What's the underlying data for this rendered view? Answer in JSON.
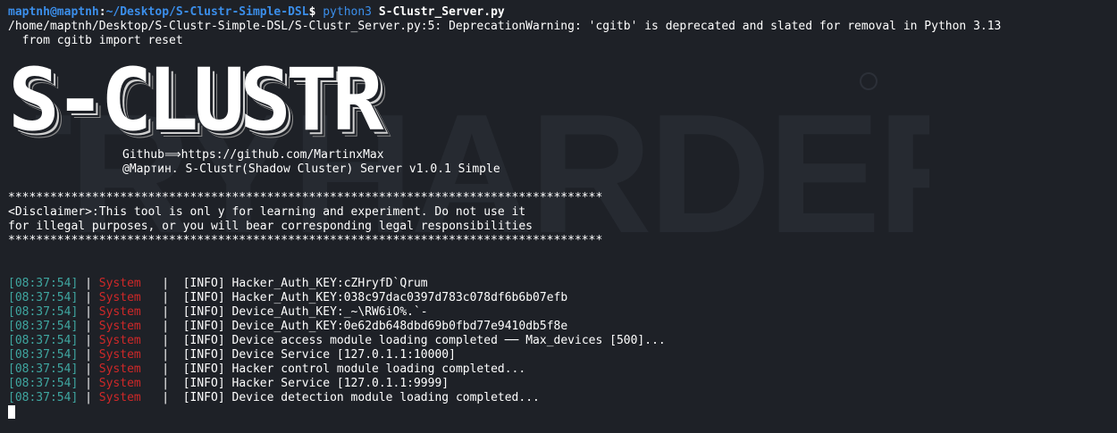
{
  "prompt": {
    "user": "maptnh@maptnh",
    "path": "~/Desktop/S-Clustr-Simple-DSL",
    "symbol": "$",
    "interpreter": "python3",
    "script": "S-Clustr_Server.py"
  },
  "warning": {
    "line1": "/home/maptnh/Desktop/S-Clustr-Simple-DSL/S-Clustr_Server.py:5: DeprecationWarning: 'cgitb' is deprecated and slated for removal in Python 3.13",
    "line2": "  from cgitb import reset"
  },
  "banner": {
    "logo": "S-CLUSTR",
    "watermark": "TRYHARDER",
    "github": "Github⟹https://github.com/MartinxMax",
    "version": "@Мартин. S-Clustr(Shadow Cluster) Server v1.0.1 Simple"
  },
  "disclaimer": {
    "border": "*************************************************************************************",
    "line1": "<Disclaimer>:This tool is onl y for learning and experiment. Do not use it",
    "line2": "for illegal purposes, or you will bear corresponding legal responsibilities"
  },
  "logs": [
    {
      "time": "[08:37:54]",
      "source": "System",
      "message": "[INFO] Hacker_Auth_KEY:cZHryfD`Qrum"
    },
    {
      "time": "[08:37:54]",
      "source": "System",
      "message": "[INFO] Hacker_Auth_KEY:038c97dac0397d783c078df6b6b07efb"
    },
    {
      "time": "[08:37:54]",
      "source": "System",
      "message": "[INFO] Device_Auth_KEY:_~\\RW6iO%.`-"
    },
    {
      "time": "[08:37:54]",
      "source": "System",
      "message": "[INFO] Device_Auth_KEY:0e62db648dbd69b0fbd77e9410db5f8e"
    },
    {
      "time": "[08:37:54]",
      "source": "System",
      "message": "[INFO] Device access module loading completed ── Max_devices [500]..."
    },
    {
      "time": "[08:37:54]",
      "source": "System",
      "message": "[INFO] Device Service [127.0.1.1:10000]"
    },
    {
      "time": "[08:37:54]",
      "source": "System",
      "message": "[INFO] Hacker control module loading completed..."
    },
    {
      "time": "[08:37:54]",
      "source": "System",
      "message": "[INFO] Hacker Service [127.0.1.1:9999]"
    },
    {
      "time": "[08:37:54]",
      "source": "System",
      "message": "[INFO] Device detection module loading completed..."
    }
  ],
  "colors": {
    "background": "#1e2127",
    "prompt": "#3b8eea",
    "timestamp": "#3fa6a0",
    "system": "#d02828"
  }
}
